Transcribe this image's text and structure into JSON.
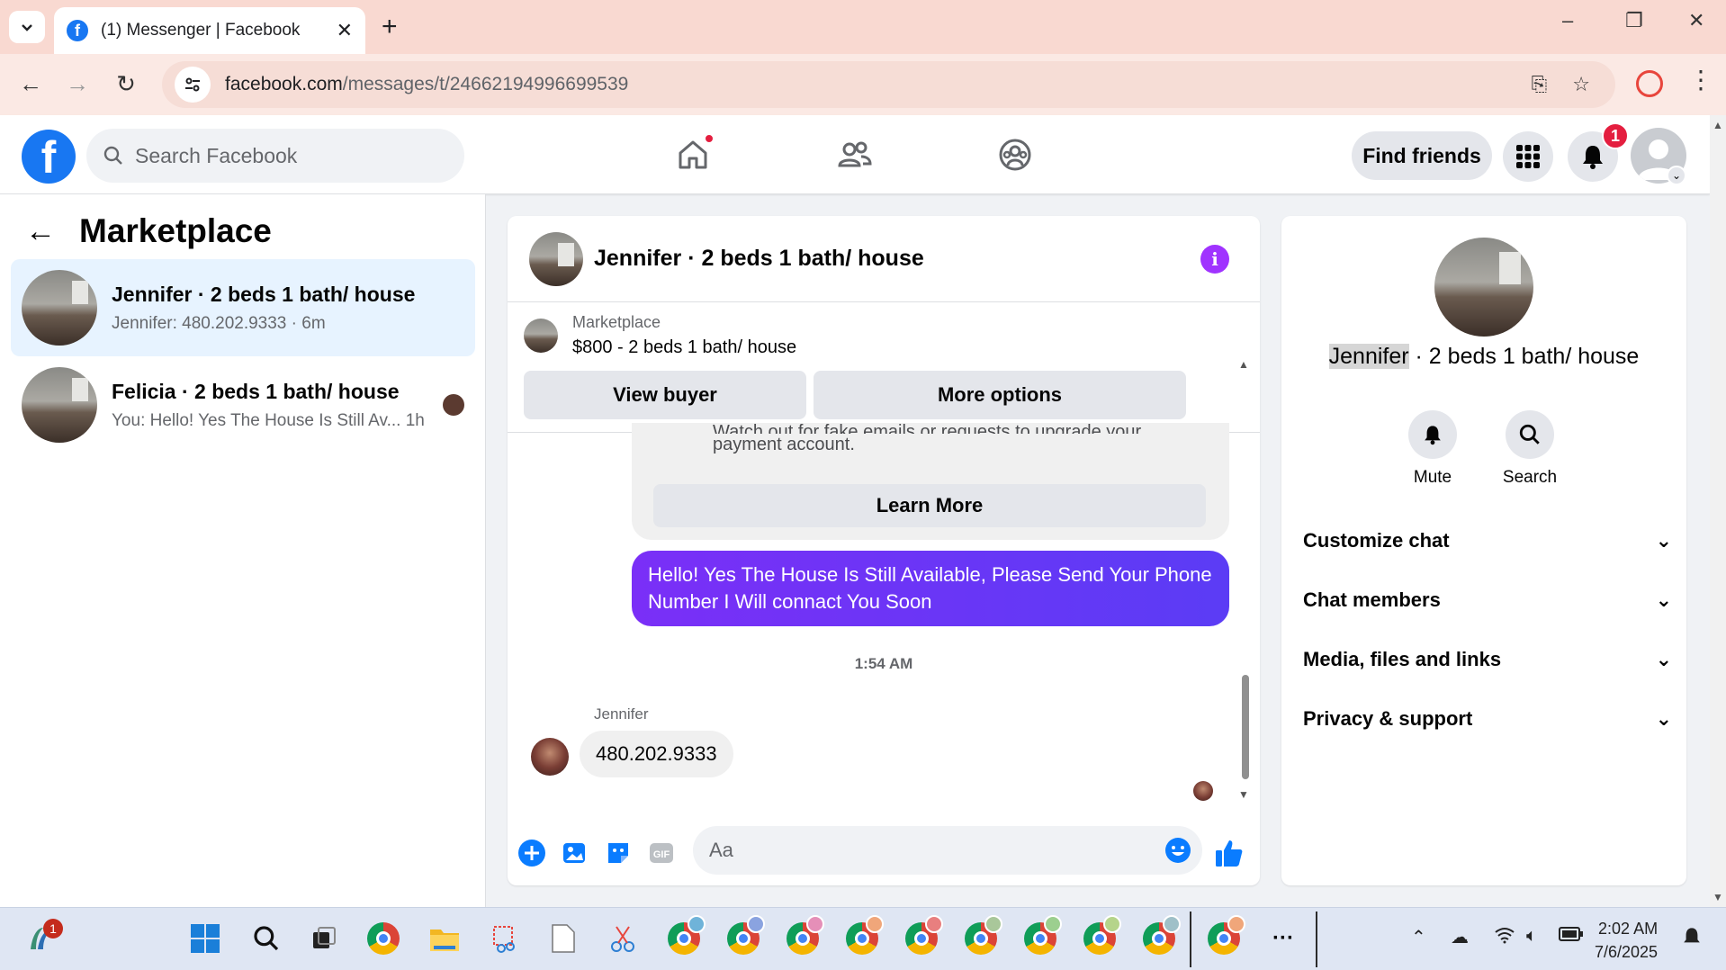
{
  "browser": {
    "tab_title": "(1) Messenger | Facebook",
    "url_host": "facebook.com",
    "url_path": "/messages/t/24662194996699539",
    "new_tab": "+",
    "window_controls": [
      "–",
      "❐",
      "✕"
    ]
  },
  "fb_header": {
    "search_placeholder": "Search Facebook",
    "find_friends": "Find friends",
    "notification_count": "1",
    "colors": {
      "brand": "#1877f2",
      "badge": "#e41e3f"
    }
  },
  "left": {
    "title": "Marketplace",
    "conversations": [
      {
        "name": "Jennifer · 2 beds 1 bath/ house",
        "snippet": "Jennifer: 480.202.9333 · 6m"
      },
      {
        "name": "Felicia · 2 beds 1 bath/ house",
        "snippet": "You: Hello! Yes The House Is Still Av...",
        "time": "1h"
      }
    ]
  },
  "chat": {
    "title": "Jennifer · 2 beds 1 bath/ house",
    "marketplace_label": "Marketplace",
    "listing": "$800 - 2 beds 1 bath/ house",
    "view_buyer": "View buyer",
    "more_options": "More options",
    "warning_line1": "Watch out for fake emails or requests to upgrade your",
    "warning_line2": "payment account.",
    "learn_more": "Learn More",
    "outgoing": "Hello! Yes The House  Is Still Available, Please Send Your Phone Number I Will connact You Soon",
    "timestamp": "1:54 AM",
    "sender": "Jennifer",
    "incoming": "480.202.9333",
    "composer_placeholder": "Aa",
    "colors": {
      "outgoing_bubble": "#6a35f6",
      "info": "#a033ff"
    }
  },
  "info_panel": {
    "name_highlight": "Jennifer",
    "name_rest": " · 2 beds 1 bath/ house",
    "mute": "Mute",
    "search": "Search",
    "sections": [
      "Customize chat",
      "Chat members",
      "Media, files and links",
      "Privacy & support"
    ]
  },
  "taskbar": {
    "weather_badge": "1",
    "time": "2:02 AM",
    "date": "7/6/2025"
  }
}
